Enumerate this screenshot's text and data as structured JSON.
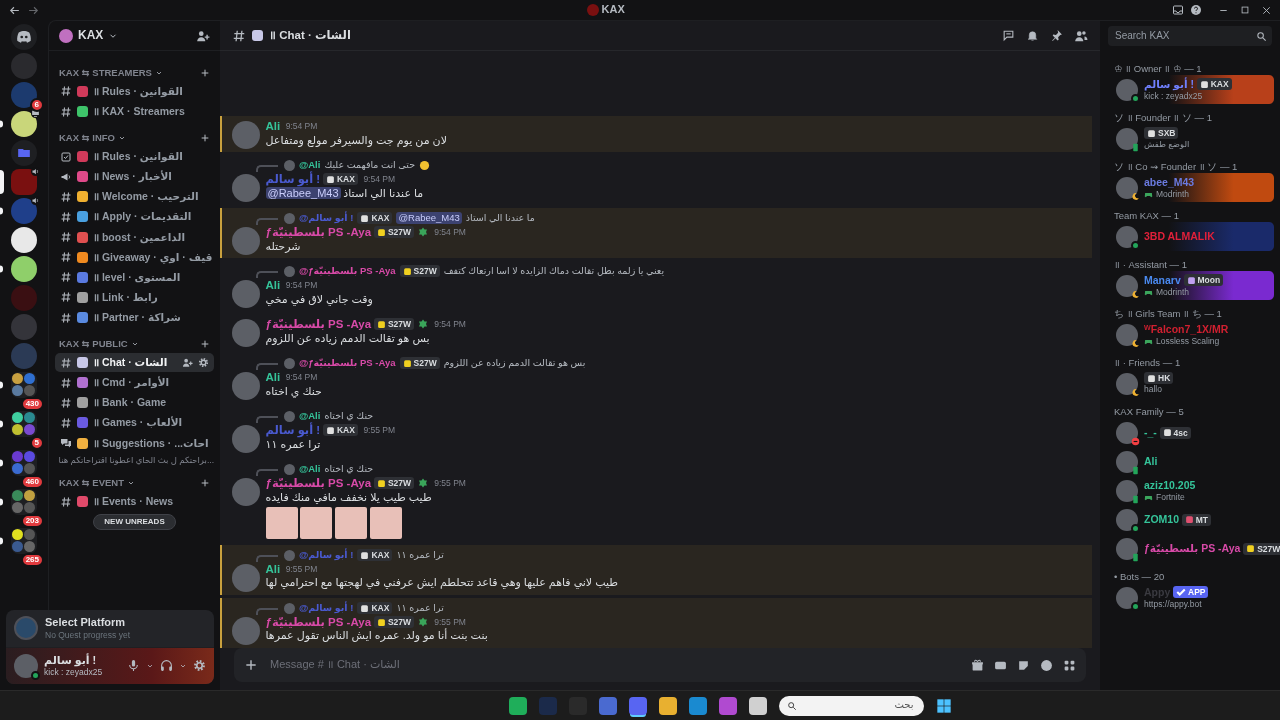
{
  "window": {
    "title": "KAX"
  },
  "servers": [
    {
      "kind": "home",
      "selected": false
    },
    {
      "kind": "server",
      "color": "#2a2a2e",
      "selected": false
    },
    {
      "kind": "server",
      "color": "#1c3a6e",
      "badge": "6",
      "selected": false
    },
    {
      "kind": "server",
      "color": "#c9d67a",
      "unread": true,
      "streaming": true,
      "selected": false
    },
    {
      "kind": "folder",
      "color": "#5865f2",
      "selected": false
    },
    {
      "kind": "server",
      "color": "#7a1010",
      "voice": true,
      "selected": true
    },
    {
      "kind": "server",
      "color": "#1f3f8a",
      "voice": true,
      "unread": true,
      "selected": false
    },
    {
      "kind": "server",
      "color": "#e8e8e8",
      "selected": false
    },
    {
      "kind": "server",
      "color": "#8fcf6a",
      "unread": true,
      "selected": false
    },
    {
      "kind": "server",
      "color": "#3a0f12",
      "selected": false
    },
    {
      "kind": "server",
      "color": "#34343a",
      "selected": false
    },
    {
      "kind": "server",
      "color": "#2b3a55",
      "selected": false
    },
    {
      "kind": "group",
      "icons": [
        {
          "color": "#c8a040"
        },
        {
          "color": "#2f6fd0"
        },
        {
          "color": "#5a7aa0"
        },
        {
          "color": "#555555"
        }
      ],
      "badge": "430",
      "unread": true,
      "selected": false
    },
    {
      "kind": "group",
      "icons": [
        {
          "color": "#3fd0a0"
        },
        {
          "color": "#2a8a90"
        },
        {
          "color": "#c0c030"
        },
        {
          "color": "#7a4ad0"
        }
      ],
      "badge": "5",
      "unread": true,
      "selected": false
    },
    {
      "kind": "group",
      "icons": [
        {
          "color": "#6a3ad0"
        },
        {
          "color": "#5a4ae0"
        },
        {
          "color": "#3a6ad0"
        },
        {
          "color": "#555555"
        }
      ],
      "badge": "460",
      "unread": true,
      "selected": false
    },
    {
      "kind": "group",
      "icons": [
        {
          "color": "#3a8a5a"
        },
        {
          "color": "#c0a040"
        },
        {
          "color": "#666666"
        },
        {
          "color": "#555555"
        }
      ],
      "badge": "203",
      "unread": true,
      "selected": false
    },
    {
      "kind": "group",
      "icons": [
        {
          "color": "#e0e020"
        },
        {
          "color": "#555555"
        },
        {
          "color": "#3a5a90"
        },
        {
          "color": "#666666"
        }
      ],
      "badge": "265",
      "unread": true,
      "selected": false
    }
  ],
  "server": {
    "name": "KAX"
  },
  "categories": [
    {
      "name": "KAX ⇆ STREAMERS",
      "channels": [
        {
          "kind": "text",
          "color": "#d03a5a",
          "name": "॥ Rules · القوانين",
          "selected": false
        },
        {
          "kind": "text",
          "color": "#3ec46a",
          "name": "॥ KAX · Streamers",
          "selected": false
        }
      ]
    },
    {
      "name": "KAX ⇆ INFO",
      "channels": [
        {
          "kind": "rules",
          "color": "#d03a5a",
          "name": "॥ Rules · القوانين",
          "selected": false
        },
        {
          "kind": "announcement",
          "color": "#e04a8a",
          "name": "॥ News · الأخبار",
          "selected": false
        },
        {
          "kind": "text",
          "color": "#f0b030",
          "name": "॥ Welcome · الترحيب",
          "selected": false
        },
        {
          "kind": "text",
          "color": "#4aa0e0",
          "name": "॥ Apply · التقديمات",
          "selected": false
        },
        {
          "kind": "text",
          "color": "#e05050",
          "name": "॥ boost · الداعمين",
          "selected": false
        },
        {
          "kind": "text",
          "color": "#f08a20",
          "name": "॥ Giveaway · قيف · اوي",
          "selected": false
        },
        {
          "kind": "text",
          "color": "#5a7ae0",
          "name": "॥ level · المستوى",
          "selected": false
        },
        {
          "kind": "text",
          "color": "#a0a0a0",
          "name": "॥ Link · رابط",
          "selected": false
        },
        {
          "kind": "text",
          "color": "#5a8ae0",
          "name": "॥ Partner · شراكة",
          "selected": false
        }
      ]
    },
    {
      "name": "KAX ⇆ PUBLIC",
      "channels": [
        {
          "kind": "text",
          "color": "#c8c8e8",
          "name": "॥ Chat · الشات",
          "selected": true
        },
        {
          "kind": "text",
          "color": "#b070d0",
          "name": "॥ Cmd · الأوامر",
          "selected": false
        },
        {
          "kind": "text",
          "color": "#a0a0a0",
          "name": "॥ Bank · Game",
          "selected": false
        },
        {
          "kind": "text",
          "color": "#6a5ae0",
          "name": "॥ Games · الألعاب",
          "selected": false
        },
        {
          "kind": "forum",
          "color": "#f0b040",
          "name": "॥ Suggestions · ...احات",
          "selected": false,
          "thread": "...براحتكم ل بث الحاي اعطونا اقتراحاتكم هنا"
        }
      ]
    },
    {
      "name": "KAX ⇆ EVENT",
      "channels": [
        {
          "kind": "text",
          "color": "#e04a6a",
          "name": "॥ Events · News",
          "selected": false
        }
      ]
    }
  ],
  "new_unreads": "NEW UNREADS",
  "quest": {
    "title": "Select Platform",
    "subtitle": "No Quest progress yet"
  },
  "user": {
    "name": "أبو سالم !",
    "status": "kick : zeyadx25",
    "online": true
  },
  "channel_header": {
    "emoji": {
      "color": "#c8c8e8"
    },
    "title": "॥ Chat · الشات"
  },
  "messages": [
    {
      "author": "Ali",
      "color": "#35c49a",
      "time": "9:54 PM",
      "text": "لان من يوم جت والسيرفر مولع ومتفاعل",
      "highlighted": true
    },
    {
      "reply": {
        "author": "@Ali",
        "color": "#35c49a",
        "text": "حتى انت مافهمت عليك",
        "emoji": true
      },
      "author": "أبو سالم !",
      "color": "#4a5ad0",
      "tag": {
        "text": "KAX",
        "color": "#e0e0e0"
      },
      "time": "9:54 PM",
      "mention": "@Rabee_M43",
      "text": "ما عندنا الي استاذ",
      "highlighted": false
    },
    {
      "reply": {
        "author": "@أبو سالم !",
        "color": "#4a5ad0",
        "tag": {
          "text": "KAX",
          "color": "#e0e0e0"
        },
        "mention": "@Rabee_M43",
        "text": "ما عندنا الي استاذ"
      },
      "author": "ƒبلسطينيّة PS -Aya",
      "color": "#d84aa8",
      "tag": {
        "text": "S27W",
        "color": "#f0d020"
      },
      "badge": true,
      "time": "9:54 PM",
      "text": "شرحتله",
      "highlighted": true
    },
    {
      "reply": {
        "author": "@ƒبلسطينيّة PS -Aya",
        "color": "#d84aa8",
        "tag": {
          "text": "S27W",
          "color": "#f0d020"
        },
        "text": "يعني يا زلمه بطل تقالت دماك الزايده لا اسا ارتعاك كتفف"
      },
      "author": "Ali",
      "color": "#35c49a",
      "time": "9:54 PM",
      "text": "وقت جاني لاق في مخي",
      "highlighted": false
    },
    {
      "author": "ƒبلسطينيّة PS -Aya",
      "color": "#d84aa8",
      "tag": {
        "text": "S27W",
        "color": "#f0d020"
      },
      "badge": true,
      "time": "9:54 PM",
      "text": "بس هو تقالت الدمم زياده عن اللزوم",
      "highlighted": false
    },
    {
      "reply": {
        "author": "@ƒبلسطينيّة PS -Aya",
        "color": "#d84aa8",
        "tag": {
          "text": "S27W",
          "color": "#f0d020"
        },
        "text": "بس هو تقالت الدمم زياده عن اللزوم"
      },
      "author": "Ali",
      "color": "#35c49a",
      "time": "9:54 PM",
      "text": "حنك ي اختاه",
      "highlighted": false
    },
    {
      "reply": {
        "author": "@Ali",
        "color": "#35c49a",
        "text": "حنك ي اختاه"
      },
      "author": "أبو سالم !",
      "color": "#4a5ad0",
      "tag": {
        "text": "KAX",
        "color": "#e0e0e0"
      },
      "time": "9:55 PM",
      "text": "ترا عمره ١١",
      "highlighted": false
    },
    {
      "reply": {
        "author": "@Ali",
        "color": "#35c49a",
        "text": "حنك ي اختاه"
      },
      "author": "ƒبلسطينيّة PS -Aya",
      "color": "#d84aa8",
      "tag": {
        "text": "S27W",
        "color": "#f0d020"
      },
      "badge": true,
      "time": "9:55 PM",
      "text": "طيب طيب يلا نخفف مافي منك فايده",
      "images": [
        {
          "kind": "photo"
        },
        {
          "kind": "photo"
        },
        {
          "kind": "photo"
        },
        {
          "kind": "photo"
        }
      ],
      "highlighted": false
    },
    {
      "reply": {
        "author": "@أبو سالم !",
        "color": "#4a5ad0",
        "tag": {
          "text": "KAX",
          "color": "#e0e0e0"
        },
        "text": "ترا عمره ١١"
      },
      "author": "Ali",
      "color": "#35c49a",
      "time": "9:55 PM",
      "text": "طيب لاني فاهم عليها وهي قاعد تتحلطم ايش عرفني في لهجتها مع احترامي لها",
      "highlighted": true
    },
    {
      "reply": {
        "author": "@أبو سالم !",
        "color": "#4a5ad0",
        "tag": {
          "text": "KAX",
          "color": "#e0e0e0"
        },
        "text": "ترا عمره ١١"
      },
      "author": "ƒبلسطينيّة PS -Aya",
      "color": "#d84aa8",
      "tag": {
        "text": "S27W",
        "color": "#f0d020"
      },
      "badge": true,
      "time": "9:55 PM",
      "text": "بنت بنت أنا مو ولد. عمره ايش الناس تقول عمرها",
      "highlighted": true
    }
  ],
  "composer": {
    "placeholder": "Message # ॥ Chat · الشات"
  },
  "member_search": {
    "placeholder": "Search KAX"
  },
  "member_groups": [
    {
      "title": "♔ ॥ Owner ॥ ♔ — 1",
      "members": [
        {
          "name": "أبو سالم !",
          "color": "#7080ff",
          "tag": {
            "text": "KAX",
            "color": "#e0e0e0"
          },
          "status_text": "kick : zeyadx25",
          "online": true,
          "banner": {
            "color": "#b8401a"
          }
        }
      ]
    },
    {
      "title": "ソ ॥ Founder ॥ ソ — 1",
      "members": [
        {
          "tag": {
            "text": "SXB",
            "color": "#e0e0e0"
          },
          "status_text": "الوضع طفش",
          "mobile": true
        }
      ]
    },
    {
      "title": "ソ ॥ Co ⇝ Founder ॥ ソ — 1",
      "members": [
        {
          "name": "abee_M43",
          "color": "#6a7ae0",
          "activity": "Modrinth",
          "idle": true,
          "banner": {
            "color": "#c04a10"
          }
        }
      ]
    },
    {
      "title": "Team KAX — 1",
      "members": [
        {
          "name": "3BD ALMALIK",
          "color": "#e0203a",
          "online": true,
          "banner": {
            "color": "#1a2a6a"
          }
        }
      ]
    },
    {
      "title": "॥ · Assistant — 1",
      "members": [
        {
          "name": "Manarv",
          "color": "#4a8af0",
          "tag": {
            "text": "Moon",
            "color": "#c0a0f0"
          },
          "activity": "Modrinth",
          "idle": true,
          "banner": {
            "color": "#7a2ad0"
          }
        }
      ]
    },
    {
      "title": "ち ॥ Girls Team ॥ ち — 1",
      "members": [
        {
          "name": "ᵂFalcon7_1X/MR",
          "color": "#d02030",
          "activity": "Lossless Scaling",
          "idle": true
        }
      ]
    },
    {
      "title": "॥ · Friends — 1",
      "members": [
        {
          "tag": {
            "text": "HK",
            "color": "#e0e0e0"
          },
          "status_text": "hallo",
          "idle": true
        }
      ]
    },
    {
      "title": "KAX Family — 5",
      "members": [
        {
          "name": "-_-",
          "color": "#35c49a",
          "tag": {
            "text": "4sc",
            "color": "#e0e0e0"
          },
          "dnd": true
        },
        {
          "name": "Ali",
          "color": "#35c49a",
          "mobile": true
        },
        {
          "name": "aziz10.205",
          "color": "#35c49a",
          "activity": "Fortnite",
          "mobile": true
        },
        {
          "name": "ZOM10",
          "color": "#35c49a",
          "tag": {
            "text": "MT",
            "color": "#e05070"
          },
          "online": true
        },
        {
          "name": "ƒبلسطينيّة PS -Aya",
          "color": "#d84aa8",
          "tag": {
            "text": "S27W",
            "color": "#f0d020"
          },
          "mobile": true
        }
      ]
    },
    {
      "title": "• Bots — 20",
      "members": [
        {
          "name": "Appy",
          "color": "#3a3a40",
          "tag": {
            "text": "APP",
            "kind": "app",
            "color": "#5865f2"
          },
          "status_text": "https://appy.bot",
          "online": true
        }
      ]
    }
  ],
  "taskbar": {
    "apps": [
      {
        "color": "#1fae5a",
        "selected": false
      },
      {
        "color": "#1b2a4a",
        "selected": false
      },
      {
        "color": "#2a2a2a",
        "selected": false
      },
      {
        "color": "#4a6ad0",
        "selected": false
      },
      {
        "color": "#5865f2",
        "selected": true
      },
      {
        "color": "#e8b030",
        "selected": false
      },
      {
        "color": "#1a8ad0",
        "selected": false
      },
      {
        "color": "#b04ad0",
        "selected": false
      },
      {
        "color": "#d0d0d0",
        "selected": false
      }
    ],
    "search": {
      "placeholder": "بحث"
    }
  }
}
